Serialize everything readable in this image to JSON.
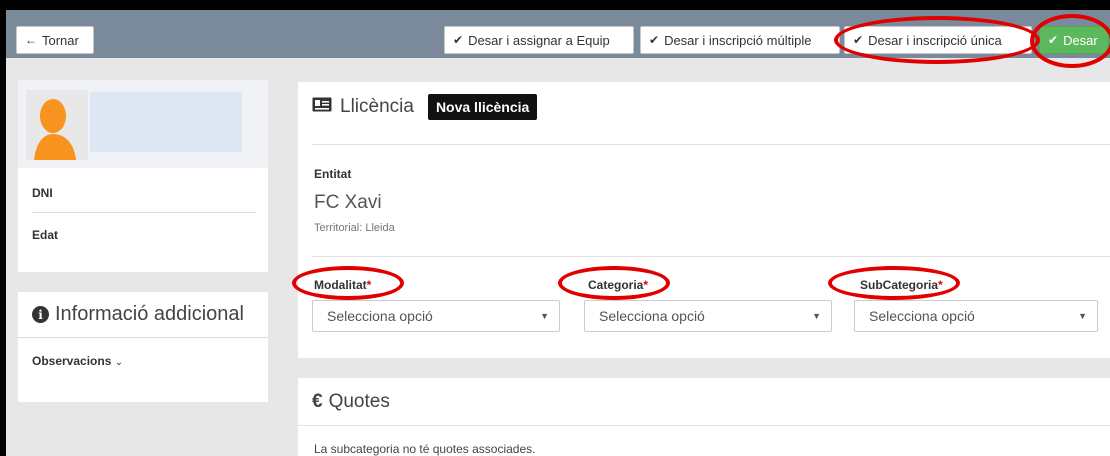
{
  "toolbar": {
    "back_label": "Tornar",
    "assign_team_label": "Desar i assignar a Equip",
    "multi_label": "Desar i inscripció múltiple",
    "single_label": "Desar i inscripció única",
    "save_label": "Desar"
  },
  "profile": {
    "dni_label": "DNI",
    "age_label": "Edat"
  },
  "info": {
    "title": "Informació addicional",
    "observations_label": "Observacions"
  },
  "licence": {
    "title": "Llicència",
    "badge": "Nova llicència",
    "entity_label": "Entitat",
    "entity_name": "FC Xavi",
    "entity_sub": "Territorial: Lleida",
    "fields": [
      {
        "label": "Modalitat",
        "required": "*",
        "placeholder": "Selecciona opció"
      },
      {
        "label": "Categoria",
        "required": "*",
        "placeholder": "Selecciona opció"
      },
      {
        "label": "SubCategoria",
        "required": "*",
        "placeholder": "Selecciona opció"
      }
    ]
  },
  "quotes": {
    "title": "Quotes",
    "empty_text": "La subcategoria no té quotes associades."
  },
  "colors": {
    "topbar": "#7a8a9b",
    "save_green": "#5cb85c",
    "highlight_red": "#e00000"
  },
  "icons": [
    "arrow-left-icon",
    "check-icon",
    "user-avatar-icon",
    "info-circle-icon",
    "id-card-icon",
    "euro-icon",
    "chevron-down-icon",
    "caret-down-icon"
  ]
}
